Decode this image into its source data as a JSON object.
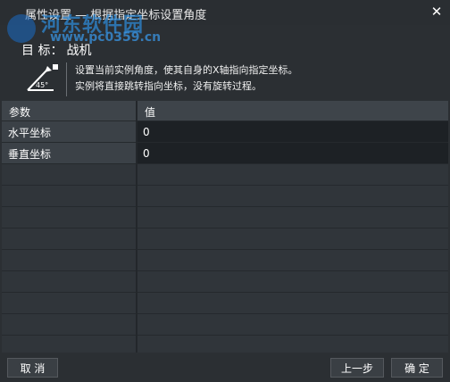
{
  "window": {
    "title": "属性设置 — 根据指定坐标设置角度"
  },
  "watermark": {
    "main": "河东软件园",
    "sub": "www.pc0359.cn"
  },
  "target": {
    "label": "目  标：",
    "value": "战机"
  },
  "description": {
    "icon": "angle-45-icon",
    "icon_text": "45°",
    "line1": "设置当前实例角度，使其自身的X轴指向指定坐标。",
    "line2": "实例将直接跳转指向坐标，没有旋转过程。"
  },
  "table": {
    "headers": {
      "param": "参数",
      "value": "值"
    },
    "rows": [
      {
        "name": "水平坐标",
        "value": "0"
      },
      {
        "name": "垂直坐标",
        "value": "0"
      }
    ]
  },
  "footer": {
    "cancel_label": "取 消",
    "prev_label": "上一步",
    "ok_label": "确 定"
  }
}
